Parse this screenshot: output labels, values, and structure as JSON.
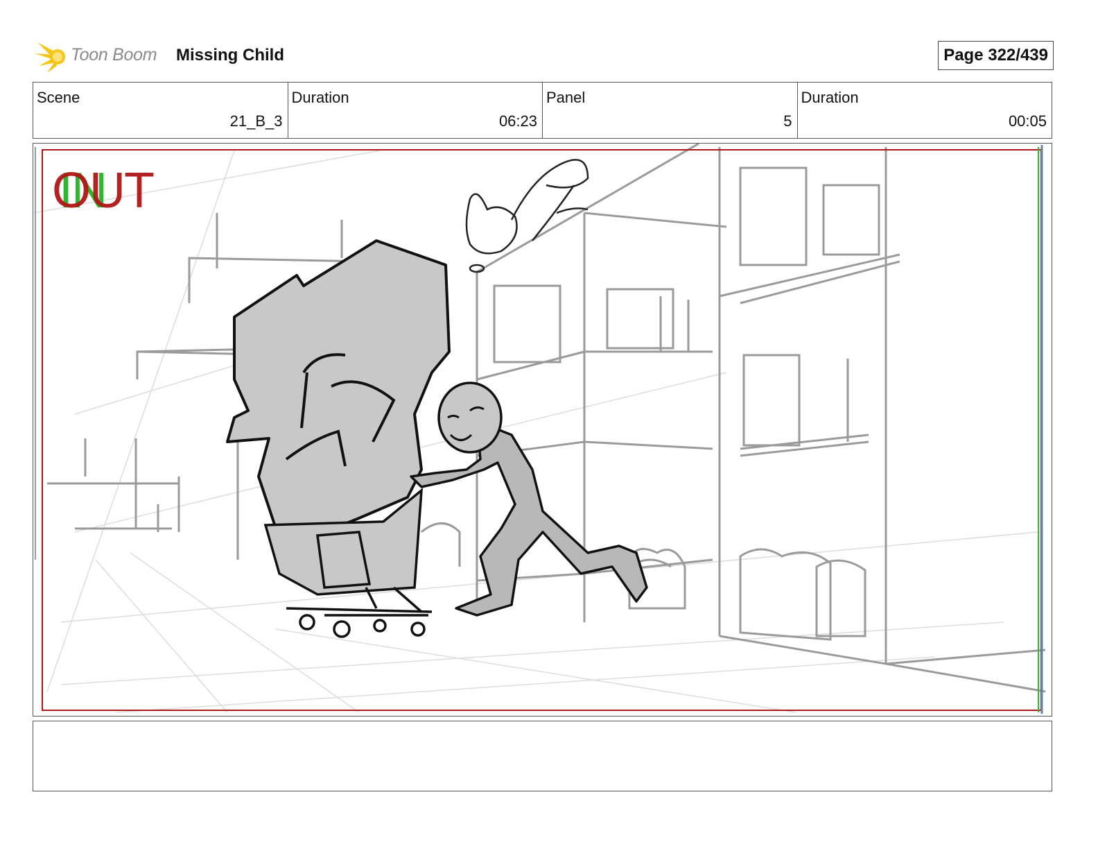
{
  "header": {
    "logo_text": "Toon Boom",
    "project_title": "Missing Child",
    "page_label": "Page 322/439"
  },
  "info": [
    {
      "label": "Scene",
      "value": "21_B_3"
    },
    {
      "label": "Duration",
      "value": "06:23"
    },
    {
      "label": "Panel",
      "value": "5"
    },
    {
      "label": "Duration",
      "value": "00:05"
    }
  ],
  "panel": {
    "in_label": "IN",
    "out_label": "OUT",
    "in_color": "#2fb52f",
    "out_color": "#b01616",
    "safe_frame_color": "#b01616",
    "sketch_color": "#9a9a9a",
    "fill_color": "#c8c8c8"
  },
  "dialogue": ""
}
